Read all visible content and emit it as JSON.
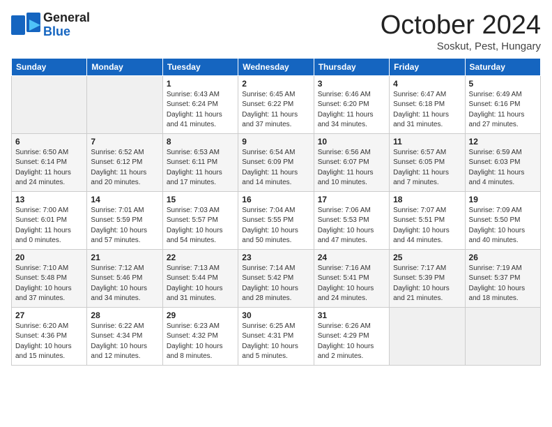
{
  "header": {
    "logo_general": "General",
    "logo_blue": "Blue",
    "month_title": "October 2024",
    "location": "Soskut, Pest, Hungary"
  },
  "days_of_week": [
    "Sunday",
    "Monday",
    "Tuesday",
    "Wednesday",
    "Thursday",
    "Friday",
    "Saturday"
  ],
  "weeks": [
    [
      {
        "num": "",
        "sunrise": "",
        "sunset": "",
        "daylight": "",
        "empty": true
      },
      {
        "num": "",
        "sunrise": "",
        "sunset": "",
        "daylight": "",
        "empty": true
      },
      {
        "num": "1",
        "sunrise": "Sunrise: 6:43 AM",
        "sunset": "Sunset: 6:24 PM",
        "daylight": "Daylight: 11 hours and 41 minutes."
      },
      {
        "num": "2",
        "sunrise": "Sunrise: 6:45 AM",
        "sunset": "Sunset: 6:22 PM",
        "daylight": "Daylight: 11 hours and 37 minutes."
      },
      {
        "num": "3",
        "sunrise": "Sunrise: 6:46 AM",
        "sunset": "Sunset: 6:20 PM",
        "daylight": "Daylight: 11 hours and 34 minutes."
      },
      {
        "num": "4",
        "sunrise": "Sunrise: 6:47 AM",
        "sunset": "Sunset: 6:18 PM",
        "daylight": "Daylight: 11 hours and 31 minutes."
      },
      {
        "num": "5",
        "sunrise": "Sunrise: 6:49 AM",
        "sunset": "Sunset: 6:16 PM",
        "daylight": "Daylight: 11 hours and 27 minutes."
      }
    ],
    [
      {
        "num": "6",
        "sunrise": "Sunrise: 6:50 AM",
        "sunset": "Sunset: 6:14 PM",
        "daylight": "Daylight: 11 hours and 24 minutes."
      },
      {
        "num": "7",
        "sunrise": "Sunrise: 6:52 AM",
        "sunset": "Sunset: 6:12 PM",
        "daylight": "Daylight: 11 hours and 20 minutes."
      },
      {
        "num": "8",
        "sunrise": "Sunrise: 6:53 AM",
        "sunset": "Sunset: 6:11 PM",
        "daylight": "Daylight: 11 hours and 17 minutes."
      },
      {
        "num": "9",
        "sunrise": "Sunrise: 6:54 AM",
        "sunset": "Sunset: 6:09 PM",
        "daylight": "Daylight: 11 hours and 14 minutes."
      },
      {
        "num": "10",
        "sunrise": "Sunrise: 6:56 AM",
        "sunset": "Sunset: 6:07 PM",
        "daylight": "Daylight: 11 hours and 10 minutes."
      },
      {
        "num": "11",
        "sunrise": "Sunrise: 6:57 AM",
        "sunset": "Sunset: 6:05 PM",
        "daylight": "Daylight: 11 hours and 7 minutes."
      },
      {
        "num": "12",
        "sunrise": "Sunrise: 6:59 AM",
        "sunset": "Sunset: 6:03 PM",
        "daylight": "Daylight: 11 hours and 4 minutes."
      }
    ],
    [
      {
        "num": "13",
        "sunrise": "Sunrise: 7:00 AM",
        "sunset": "Sunset: 6:01 PM",
        "daylight": "Daylight: 11 hours and 0 minutes."
      },
      {
        "num": "14",
        "sunrise": "Sunrise: 7:01 AM",
        "sunset": "Sunset: 5:59 PM",
        "daylight": "Daylight: 10 hours and 57 minutes."
      },
      {
        "num": "15",
        "sunrise": "Sunrise: 7:03 AM",
        "sunset": "Sunset: 5:57 PM",
        "daylight": "Daylight: 10 hours and 54 minutes."
      },
      {
        "num": "16",
        "sunrise": "Sunrise: 7:04 AM",
        "sunset": "Sunset: 5:55 PM",
        "daylight": "Daylight: 10 hours and 50 minutes."
      },
      {
        "num": "17",
        "sunrise": "Sunrise: 7:06 AM",
        "sunset": "Sunset: 5:53 PM",
        "daylight": "Daylight: 10 hours and 47 minutes."
      },
      {
        "num": "18",
        "sunrise": "Sunrise: 7:07 AM",
        "sunset": "Sunset: 5:51 PM",
        "daylight": "Daylight: 10 hours and 44 minutes."
      },
      {
        "num": "19",
        "sunrise": "Sunrise: 7:09 AM",
        "sunset": "Sunset: 5:50 PM",
        "daylight": "Daylight: 10 hours and 40 minutes."
      }
    ],
    [
      {
        "num": "20",
        "sunrise": "Sunrise: 7:10 AM",
        "sunset": "Sunset: 5:48 PM",
        "daylight": "Daylight: 10 hours and 37 minutes."
      },
      {
        "num": "21",
        "sunrise": "Sunrise: 7:12 AM",
        "sunset": "Sunset: 5:46 PM",
        "daylight": "Daylight: 10 hours and 34 minutes."
      },
      {
        "num": "22",
        "sunrise": "Sunrise: 7:13 AM",
        "sunset": "Sunset: 5:44 PM",
        "daylight": "Daylight: 10 hours and 31 minutes."
      },
      {
        "num": "23",
        "sunrise": "Sunrise: 7:14 AM",
        "sunset": "Sunset: 5:42 PM",
        "daylight": "Daylight: 10 hours and 28 minutes."
      },
      {
        "num": "24",
        "sunrise": "Sunrise: 7:16 AM",
        "sunset": "Sunset: 5:41 PM",
        "daylight": "Daylight: 10 hours and 24 minutes."
      },
      {
        "num": "25",
        "sunrise": "Sunrise: 7:17 AM",
        "sunset": "Sunset: 5:39 PM",
        "daylight": "Daylight: 10 hours and 21 minutes."
      },
      {
        "num": "26",
        "sunrise": "Sunrise: 7:19 AM",
        "sunset": "Sunset: 5:37 PM",
        "daylight": "Daylight: 10 hours and 18 minutes."
      }
    ],
    [
      {
        "num": "27",
        "sunrise": "Sunrise: 6:20 AM",
        "sunset": "Sunset: 4:36 PM",
        "daylight": "Daylight: 10 hours and 15 minutes."
      },
      {
        "num": "28",
        "sunrise": "Sunrise: 6:22 AM",
        "sunset": "Sunset: 4:34 PM",
        "daylight": "Daylight: 10 hours and 12 minutes."
      },
      {
        "num": "29",
        "sunrise": "Sunrise: 6:23 AM",
        "sunset": "Sunset: 4:32 PM",
        "daylight": "Daylight: 10 hours and 8 minutes."
      },
      {
        "num": "30",
        "sunrise": "Sunrise: 6:25 AM",
        "sunset": "Sunset: 4:31 PM",
        "daylight": "Daylight: 10 hours and 5 minutes."
      },
      {
        "num": "31",
        "sunrise": "Sunrise: 6:26 AM",
        "sunset": "Sunset: 4:29 PM",
        "daylight": "Daylight: 10 hours and 2 minutes."
      },
      {
        "num": "",
        "sunrise": "",
        "sunset": "",
        "daylight": "",
        "empty": true
      },
      {
        "num": "",
        "sunrise": "",
        "sunset": "",
        "daylight": "",
        "empty": true
      }
    ]
  ]
}
